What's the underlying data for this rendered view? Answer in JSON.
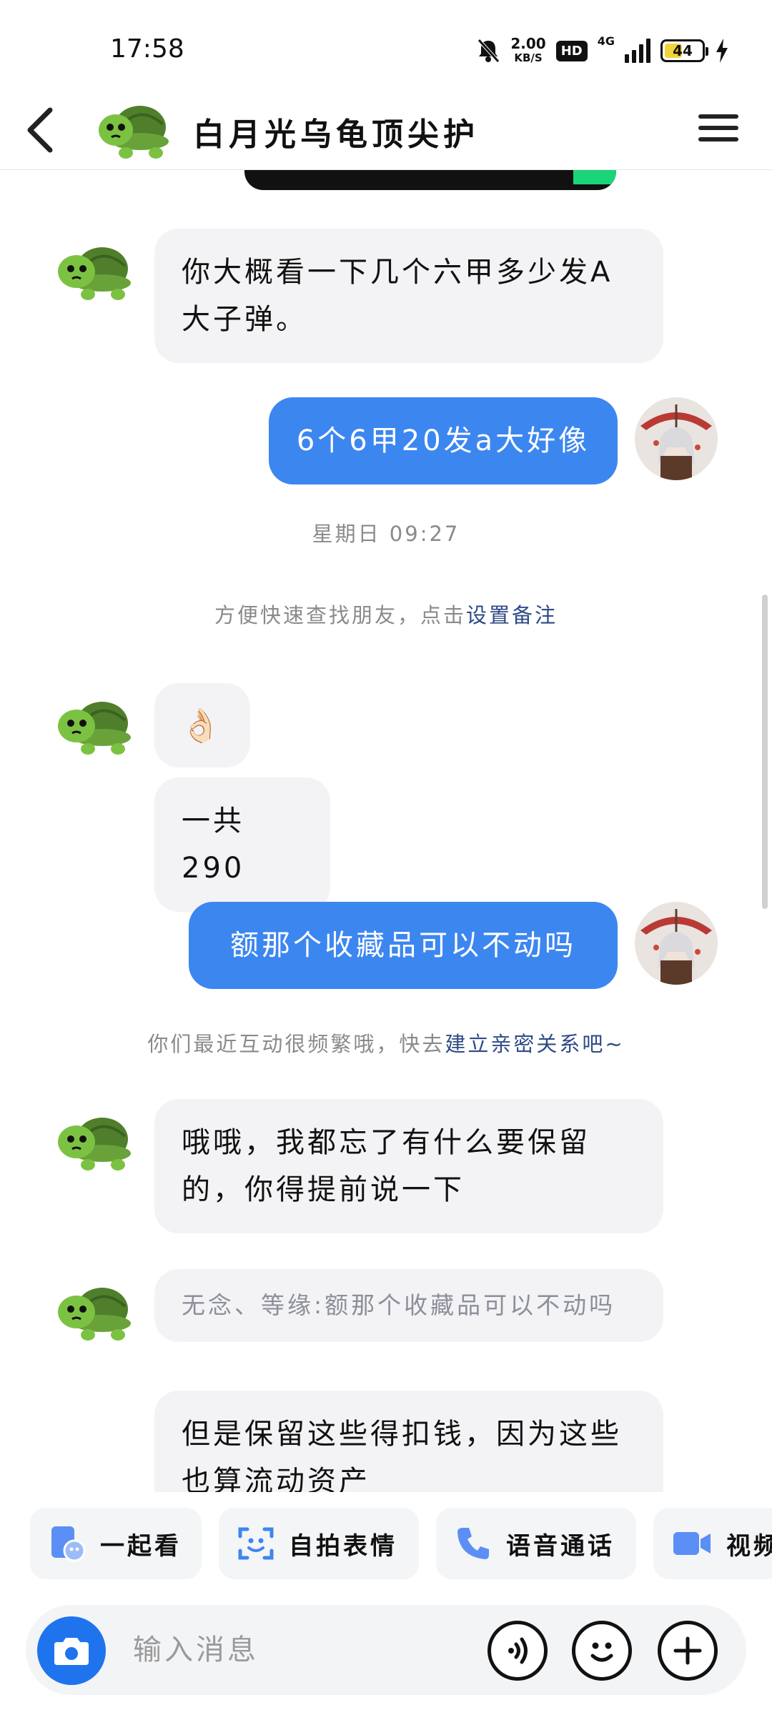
{
  "status_bar": {
    "time": "17:58",
    "net_speed_value": "2.00",
    "net_speed_unit": "KB/S",
    "hd_label": "HD",
    "network_type": "4G",
    "battery_level": "44"
  },
  "header": {
    "title": "白月光乌龟顶尖护"
  },
  "messages": {
    "m1": "你大概看一下几个六甲多少发A大子弹。",
    "m2": "6个6甲20发a大好像",
    "timestamp": "星期日 09:27",
    "remark_hint": "方便快速查找朋友，点击",
    "remark_link": "设置备注",
    "m3_emoji": "👌🏻",
    "m4": "一共290",
    "m5": "额那个收藏品可以不动吗",
    "intimacy_hint": "你们最近互动很频繁哦，快去",
    "intimacy_link": "建立亲密关系吧~",
    "m6": "哦哦，我都忘了有什么要保留的，你得提前说一下",
    "m7_quote": "无念、等缘:额那个收藏品可以不动吗",
    "m8": "但是保留这些得扣钱，因为这些也算流动资产"
  },
  "quick_actions": {
    "watch_together": "一起看",
    "selfie_sticker": "自拍表情",
    "voice_call": "语音通话",
    "video_call": "视频"
  },
  "input": {
    "placeholder": "输入消息"
  },
  "colors": {
    "accent_blue": "#3c86f0",
    "bubble_gray": "#f3f3f5",
    "link_navy": "#2f4a86"
  }
}
